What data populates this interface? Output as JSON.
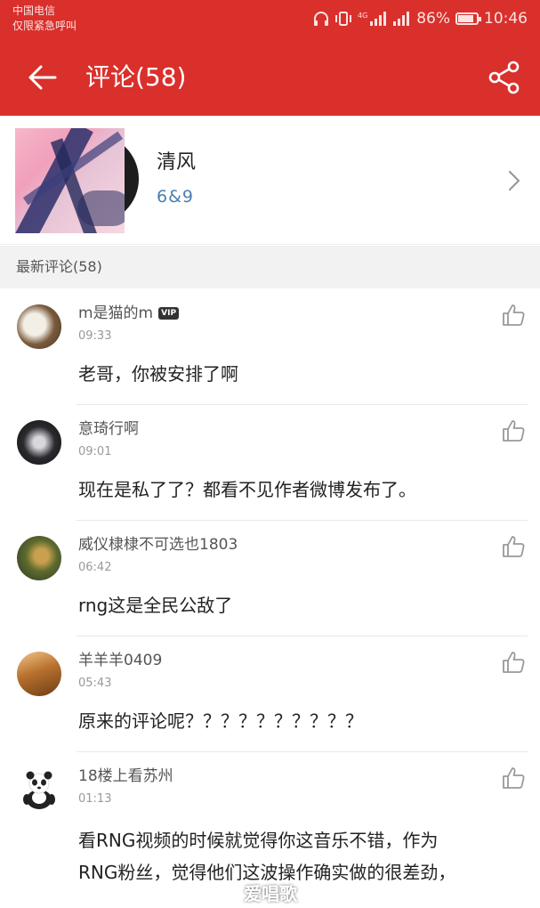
{
  "status_bar": {
    "carrier": "中国电信",
    "emergency": "仅限紧急呼叫",
    "network": "4G",
    "battery_percent": "86%",
    "battery_level": 0.86,
    "time": "10:46"
  },
  "app_bar": {
    "title": "评论(58)",
    "color": "#d9302c"
  },
  "song": {
    "title": "清风",
    "artist": "6&9"
  },
  "section": {
    "title": "最新评论(58)"
  },
  "comments": [
    {
      "username": "m是猫的m",
      "badge": "VIP",
      "time": "09:33",
      "text": "老哥，你被安排了啊"
    },
    {
      "username": "意琦行啊",
      "time": "09:01",
      "text": "现在是私了了？都看不见作者微博发布了。"
    },
    {
      "username": "威仪棣棣不可选也1803",
      "time": "06:42",
      "text": "rng这是全民公敌了"
    },
    {
      "username": "羊羊羊0409",
      "time": "05:43",
      "text": "原来的评论呢？？？？？？？？？？"
    },
    {
      "username": "18楼上看苏州",
      "time": "01:13",
      "text_lines": [
        "看RNG视频的时候就觉得你这音乐不错，作为",
        "RNG粉丝，觉得他们这波操作确实做的很差劲，"
      ]
    }
  ],
  "watermark": "爱唱歌",
  "icons": {
    "back": "arrow-left-icon",
    "share": "share-icon",
    "chevron": "chevron-right-icon",
    "like": "thumbs-up-icon"
  }
}
